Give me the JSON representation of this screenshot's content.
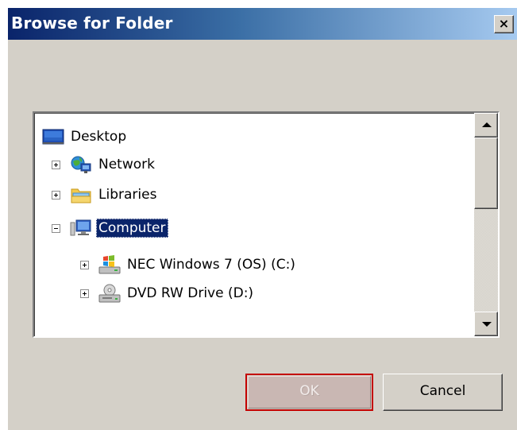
{
  "window": {
    "title": "Browse for Folder",
    "close_glyph": "×"
  },
  "tree": {
    "items": [
      {
        "label": "Desktop",
        "icon": "desktop-icon",
        "expander": "none",
        "selected": false
      },
      {
        "label": "Network",
        "icon": "network-icon",
        "expander": "plus",
        "selected": false
      },
      {
        "label": "Libraries",
        "icon": "libraries-icon",
        "expander": "plus",
        "selected": false
      },
      {
        "label": "Computer",
        "icon": "computer-icon",
        "expander": "minus",
        "selected": true
      },
      {
        "label": "NEC Windows 7 (OS) (C:)",
        "icon": "windows-drive-icon",
        "expander": "plus",
        "selected": false
      },
      {
        "label": "DVD RW Drive (D:)",
        "icon": "dvd-drive-icon",
        "expander": "plus",
        "selected": false
      }
    ]
  },
  "buttons": {
    "ok_label": "OK",
    "cancel_label": "Cancel"
  },
  "colors": {
    "selection": "#0a246a",
    "ok_focus_border": "#c40000",
    "dialog_face": "#d4d0c8"
  }
}
